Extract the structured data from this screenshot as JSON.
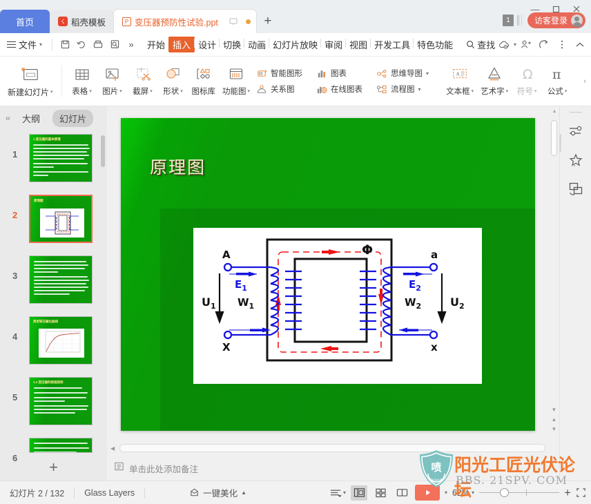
{
  "window": {
    "minimize": "—",
    "maximize": "▢",
    "close": "✕",
    "tab_count_badge": "1",
    "login_label": "访客登录"
  },
  "tabs": [
    {
      "id": "home",
      "label": "首页",
      "icon": "home-icon"
    },
    {
      "id": "template",
      "label": "稻壳模板",
      "icon": "docer-logo-icon"
    },
    {
      "id": "document",
      "label": "变压器预防性试验.ppt",
      "icon": "ppt-file-icon"
    }
  ],
  "tab_add_label": "+",
  "menubar": {
    "file_label": "文件",
    "quick_icons": [
      "save-icon",
      "undo-icon",
      "print-icon",
      "print-preview-icon",
      "more-chevron"
    ],
    "overflow": "»",
    "tabs": [
      "开始",
      "插入",
      "设计",
      "切换",
      "动画",
      "幻灯片放映",
      "审阅",
      "视图",
      "开发工具",
      "特色功能"
    ],
    "active_tab": "插入",
    "find_label": "查找",
    "right_icons": [
      "cloud-sync-icon",
      "add-collaborator-icon",
      "share-icon",
      "more-options-icon",
      "collapse-ribbon-icon"
    ]
  },
  "ribbon": {
    "new_slide": {
      "label": "新建幻灯片",
      "icon": "new-slide-icon",
      "has_caret": true
    },
    "items": [
      {
        "label": "表格",
        "icon": "table-icon",
        "has_caret": true
      },
      {
        "label": "图片",
        "icon": "picture-icon",
        "has_caret": true
      },
      {
        "label": "截屏",
        "icon": "screenshot-icon",
        "has_caret": true
      },
      {
        "label": "形状",
        "icon": "shapes-icon",
        "has_caret": true
      },
      {
        "label": "图标库",
        "icon": "icon-library-icon",
        "has_caret": false
      },
      {
        "label": "功能图",
        "icon": "function-chart-icon",
        "has_caret": true
      }
    ],
    "stack_a": [
      {
        "label": "智能图形",
        "icon": "smart-art-icon",
        "has_caret": false
      },
      {
        "label": "关系图",
        "icon": "relation-chart-icon",
        "has_caret": false
      }
    ],
    "stack_b": [
      {
        "label": "图表",
        "icon": "chart-icon",
        "has_caret": false
      },
      {
        "label": "在线图表",
        "icon": "online-chart-icon",
        "has_caret": false
      }
    ],
    "stack_c": [
      {
        "label": "思维导图",
        "icon": "mindmap-icon",
        "has_caret": true
      },
      {
        "label": "流程图",
        "icon": "flowchart-icon",
        "has_caret": true
      }
    ],
    "text_items": [
      {
        "label": "文本框",
        "icon": "textbox-icon",
        "has_caret": true,
        "disabled": false
      },
      {
        "label": "艺术字",
        "icon": "wordart-icon",
        "has_caret": true,
        "disabled": false
      },
      {
        "label": "符号",
        "icon": "symbol-icon",
        "has_caret": true,
        "disabled": true
      },
      {
        "label": "公式",
        "icon": "formula-icon",
        "has_caret": true,
        "disabled": false
      }
    ],
    "expand_icon": "›"
  },
  "left_panel": {
    "collapse_icon": "‹‹",
    "tabs": [
      {
        "label": "大纲",
        "selected": false
      },
      {
        "label": "幻灯片",
        "selected": true
      }
    ],
    "add_slide_label": "+",
    "thumbnails": [
      {
        "number": "1",
        "type": "text",
        "title": "1.变压器的基本原理",
        "selected": false
      },
      {
        "number": "2",
        "type": "diagram",
        "title": "原理图",
        "selected": true
      },
      {
        "number": "3",
        "type": "text",
        "title": "",
        "selected": false
      },
      {
        "number": "4",
        "type": "chart",
        "title": "典型铁芯磁化曲线",
        "selected": false
      },
      {
        "number": "5",
        "type": "text",
        "title": "1.2 变压器的绕组结构",
        "selected": false
      },
      {
        "number": "6",
        "type": "text",
        "title": "",
        "selected": false
      }
    ]
  },
  "slide": {
    "title": "原理图",
    "diagram": {
      "name": "transformer-principle-diagram",
      "labels": {
        "primary_top": "A",
        "primary_bottom": "X",
        "secondary_top": "a",
        "secondary_bottom": "x",
        "emf_primary": "E",
        "emf_primary_sub": "1",
        "emf_secondary": "E",
        "emf_secondary_sub": "2",
        "voltage_primary": "U",
        "voltage_primary_sub": "1",
        "voltage_secondary": "U",
        "voltage_secondary_sub": "2",
        "turns_primary": "W",
        "turns_primary_sub": "1",
        "turns_secondary": "W",
        "turns_secondary_sub": "2",
        "flux": "Φ"
      },
      "colors": {
        "winding": "#0000ee",
        "flux": "#ee1111",
        "core": "#111111"
      }
    }
  },
  "editor": {
    "notes_placeholder": "单击此处添加备注",
    "notes_icon": "notes-icon",
    "prev_slide_icon": "▲",
    "next_slide_icon": "▼"
  },
  "right_rail": {
    "items": [
      {
        "icon": "adjust-sliders-icon",
        "name": "design-ideas"
      },
      {
        "icon": "magic-star-icon",
        "name": "beautify"
      },
      {
        "icon": "duplicate-layers-icon",
        "name": "layers"
      }
    ]
  },
  "statusbar": {
    "slide_counter": "幻灯片 2 / 132",
    "theme_name": "Glass Layers",
    "beautify_label": "一键美化",
    "beautify_icon": "magic-hat-icon",
    "beautify_caret": "▲",
    "align_icon": "text-align-icon",
    "views": [
      {
        "icon": "normal-view-icon",
        "name": "normal-view",
        "selected": true
      },
      {
        "icon": "slide-sorter-icon",
        "name": "slide-sorter-view",
        "selected": false
      },
      {
        "icon": "reading-view-icon",
        "name": "reading-view",
        "selected": false
      }
    ],
    "play_icon": "play-icon",
    "play_caret": "▾",
    "zoom_label": "62%",
    "zoom_caret": "▾",
    "zoom_value": 62,
    "zoom_in": "+",
    "fit_icon": "fit-to-window-icon"
  },
  "watermark": {
    "title": "阳光工匠光伏论坛",
    "url": "BBS. 21SPV. COM",
    "shield_year": "2007",
    "shield_icon": "shield-logo-icon"
  },
  "colors": {
    "accent_orange": "#e8622c",
    "home_tab_blue": "#5b7fe0",
    "login_red": "#e8685a",
    "slide_green": "#0a9a08",
    "play_coral": "#f3705a"
  }
}
